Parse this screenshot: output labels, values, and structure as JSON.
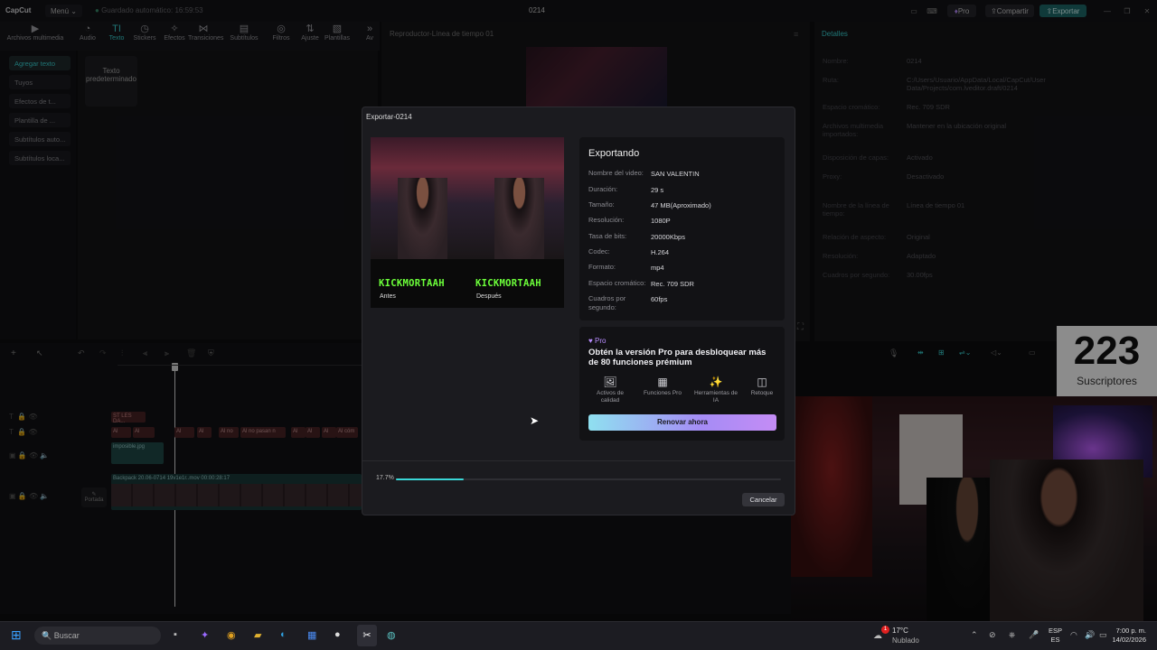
{
  "titlebar": {
    "logo": "CapCut",
    "menu_label": "Menú",
    "autosave": "Guardado automático: 16:59:53",
    "project_title": "0214",
    "pro_label": "Pro",
    "share_label": "Compartir",
    "export_label": "Exportar"
  },
  "toolbar": {
    "tools": [
      {
        "label": "Archivos multimedia",
        "icon": "media-icon"
      },
      {
        "label": "Audio",
        "icon": "audio-icon"
      },
      {
        "label": "Texto",
        "icon": "text-icon"
      },
      {
        "label": "Stickers",
        "icon": "sticker-icon"
      },
      {
        "label": "Efectos",
        "icon": "effects-icon"
      },
      {
        "label": "Transiciones",
        "icon": "transition-icon"
      },
      {
        "label": "Subtítulos",
        "icon": "subtitle-icon"
      },
      {
        "label": "Filtros",
        "icon": "filter-icon"
      },
      {
        "label": "Ajuste",
        "icon": "adjust-icon"
      },
      {
        "label": "Plantillas",
        "icon": "template-icon"
      },
      {
        "label": "Av",
        "icon": "more-icon"
      }
    ]
  },
  "left_panel": {
    "items": [
      "Agregar texto",
      "Tuyos",
      "Efectos de t...",
      "Plantilla de ...",
      "Subtítulos auto...",
      "Subtítulos loca..."
    ]
  },
  "text_panel": {
    "default_text": "Texto predeterminado"
  },
  "player": {
    "title": "Reproductor-Línea de tiempo 01"
  },
  "details": {
    "title": "Detalles",
    "rows": [
      {
        "label": "Nombre:",
        "value": "0214"
      },
      {
        "label": "Ruta:",
        "value": "C:/Users/Usuario/AppData/Local/CapCut/User Data/Projects/com.lveditor.draft/0214"
      },
      {
        "label": "Espacio cromático:",
        "value": "Rec. 709 SDR"
      },
      {
        "label": "Archivos multimedia importados:",
        "value": "Mantener en la ubicación original"
      },
      {
        "label": "Disposición de capas:",
        "value": "Activado"
      },
      {
        "label": "Proxy:",
        "value": "Desactivado"
      },
      {
        "label": "Nombre de la línea de tiempo:",
        "value": "Línea de tiempo 01"
      },
      {
        "label": "Relación de aspecto:",
        "value": "Original"
      },
      {
        "label": "Resolución:",
        "value": "Adaptado"
      },
      {
        "label": "Cuadros por segundo:",
        "value": "30.00fps"
      }
    ]
  },
  "timeline": {
    "clip_labels": [
      "ST LES DA...",
      "Al",
      "Al no",
      "Al no pasan n",
      "Al cóm"
    ],
    "audio_clip": "imposible.jpg",
    "main_clip": "Backpack 20.06-0714 19v1e1r..mov  00:00:28:17",
    "cover_label": "Portada"
  },
  "export_dialog": {
    "title": "Exportar-0214",
    "preview": {
      "kick_text": "KICKMORTAAH",
      "before_label": "Antes",
      "after_label": "Después"
    },
    "heading": "Exportando",
    "info": [
      {
        "label": "Nombre del video:",
        "value": "SAN VALENTIN"
      },
      {
        "label": "Duración:",
        "value": "29 s"
      },
      {
        "label": "Tamaño:",
        "value": "47 MB(Aproximado)"
      },
      {
        "label": "Resolución:",
        "value": "1080P"
      },
      {
        "label": "Tasa de bits:",
        "value": "20000Kbps"
      },
      {
        "label": "Codec:",
        "value": "H.264"
      },
      {
        "label": "Formato:",
        "value": "mp4"
      },
      {
        "label": "Espacio cromático:",
        "value": "Rec. 709 SDR"
      },
      {
        "label": "Cuadros por segundo:",
        "value": "60fps"
      }
    ],
    "pro": {
      "badge": "Pro",
      "text": "Obtén la versión Pro para desbloquear más de 80 funciones prémium",
      "features": [
        {
          "label": "Activos de calidad",
          "icon": "image-icon"
        },
        {
          "label": "Funciones Pro",
          "icon": "grid-icon"
        },
        {
          "label": "Herramientas de IA",
          "icon": "magic-wand-icon"
        },
        {
          "label": "Retoque",
          "icon": "retouch-icon"
        }
      ],
      "renew_label": "Renovar ahora"
    },
    "progress_label": "17.7%",
    "progress_value": 0.177,
    "cancel_label": "Cancelar"
  },
  "subscriber_overlay": {
    "count": "223",
    "label": "Suscriptores"
  },
  "taskbar": {
    "search_placeholder": "Buscar",
    "weather_temp": "17°C",
    "weather_desc": "Nublado",
    "lang_top": "ESP",
    "lang_bottom": "ES",
    "time": "7:00 p. m.",
    "date": "14/02/2026",
    "notification_count": "1"
  },
  "colors": {
    "accent": "#3ad6d6",
    "pro": "#b88cff",
    "kick_green": "#6cff3a"
  }
}
